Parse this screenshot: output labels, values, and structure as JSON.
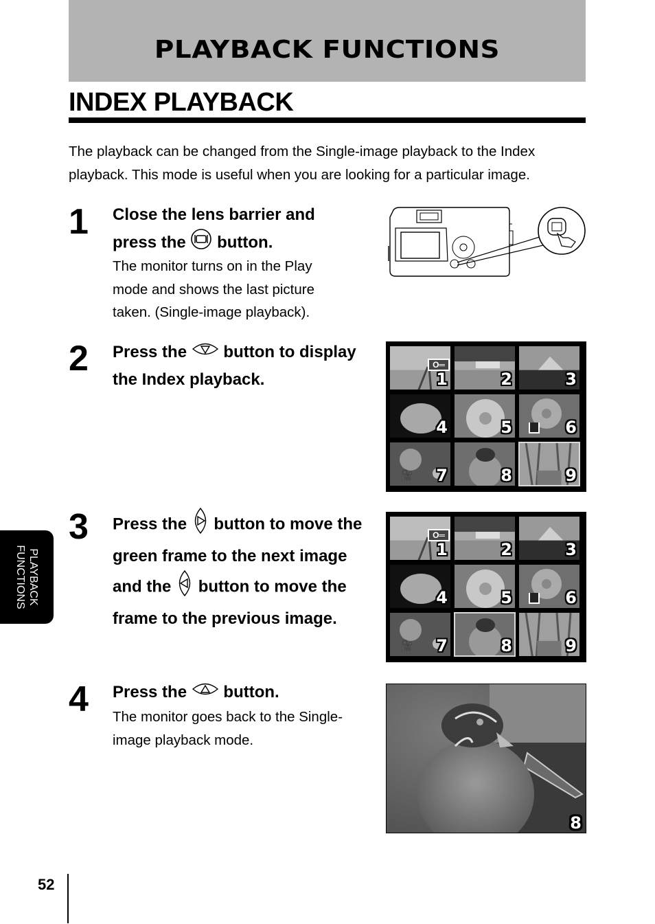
{
  "header": {
    "banner_title": "PLAYBACK FUNCTIONS",
    "section_title": "INDEX PLAYBACK"
  },
  "intro": "The playback can be changed from the Single-image playback to the Index playback. This mode is useful when you are looking for a particular image.",
  "steps": [
    {
      "number": "1",
      "head_pre": "Close the lens barrier and press the",
      "head_icon": "monitor-button-icon",
      "head_post": "button.",
      "body": "The monitor turns on in the Play mode and shows the last picture taken. (Single-image playback)."
    },
    {
      "number": "2",
      "head_pre": "Press the",
      "head_icon": "arrow-down-button-icon",
      "head_post": "button to display the Index playback."
    },
    {
      "number": "3",
      "head_pre": "Press the",
      "head_icon": "arrow-right-button-icon",
      "head_mid": "button to move the green frame to the next image and the",
      "head_icon2": "arrow-left-button-icon",
      "head_post": "button to move the frame to the previous image."
    },
    {
      "number": "4",
      "head_pre": "Press the",
      "head_icon": "arrow-up-button-icon",
      "head_post": "button.",
      "body": "The monitor goes back to the Single-image playback mode."
    }
  ],
  "index_grid_1": {
    "selected": 9,
    "thumbs": [
      {
        "num": "1",
        "subject": "railway",
        "badge": "protect-key-icon"
      },
      {
        "num": "2",
        "subject": "farmhouse"
      },
      {
        "num": "3",
        "subject": "mountain"
      },
      {
        "num": "4",
        "subject": "lily"
      },
      {
        "num": "5",
        "subject": "daisy"
      },
      {
        "num": "6",
        "subject": "flower",
        "badge": "print-icon"
      },
      {
        "num": "7",
        "subject": "flowers",
        "badge": "movie-icon"
      },
      {
        "num": "8",
        "subject": "duck"
      },
      {
        "num": "9",
        "subject": "grass"
      }
    ]
  },
  "index_grid_2": {
    "selected": 8,
    "thumbs": [
      {
        "num": "1",
        "subject": "railway",
        "badge": "protect-key-icon"
      },
      {
        "num": "2",
        "subject": "farmhouse"
      },
      {
        "num": "3",
        "subject": "mountain"
      },
      {
        "num": "4",
        "subject": "lily"
      },
      {
        "num": "5",
        "subject": "daisy"
      },
      {
        "num": "6",
        "subject": "flower",
        "badge": "print-icon"
      },
      {
        "num": "7",
        "subject": "flowers",
        "badge": "movie-icon"
      },
      {
        "num": "8",
        "subject": "duck"
      },
      {
        "num": "9",
        "subject": "grass"
      }
    ]
  },
  "single_image": {
    "num": "8",
    "subject": "duck"
  },
  "side_tab": {
    "line1": "PLAYBACK",
    "line2": "FUNCTIONS"
  },
  "footer": {
    "page_number": "52"
  }
}
